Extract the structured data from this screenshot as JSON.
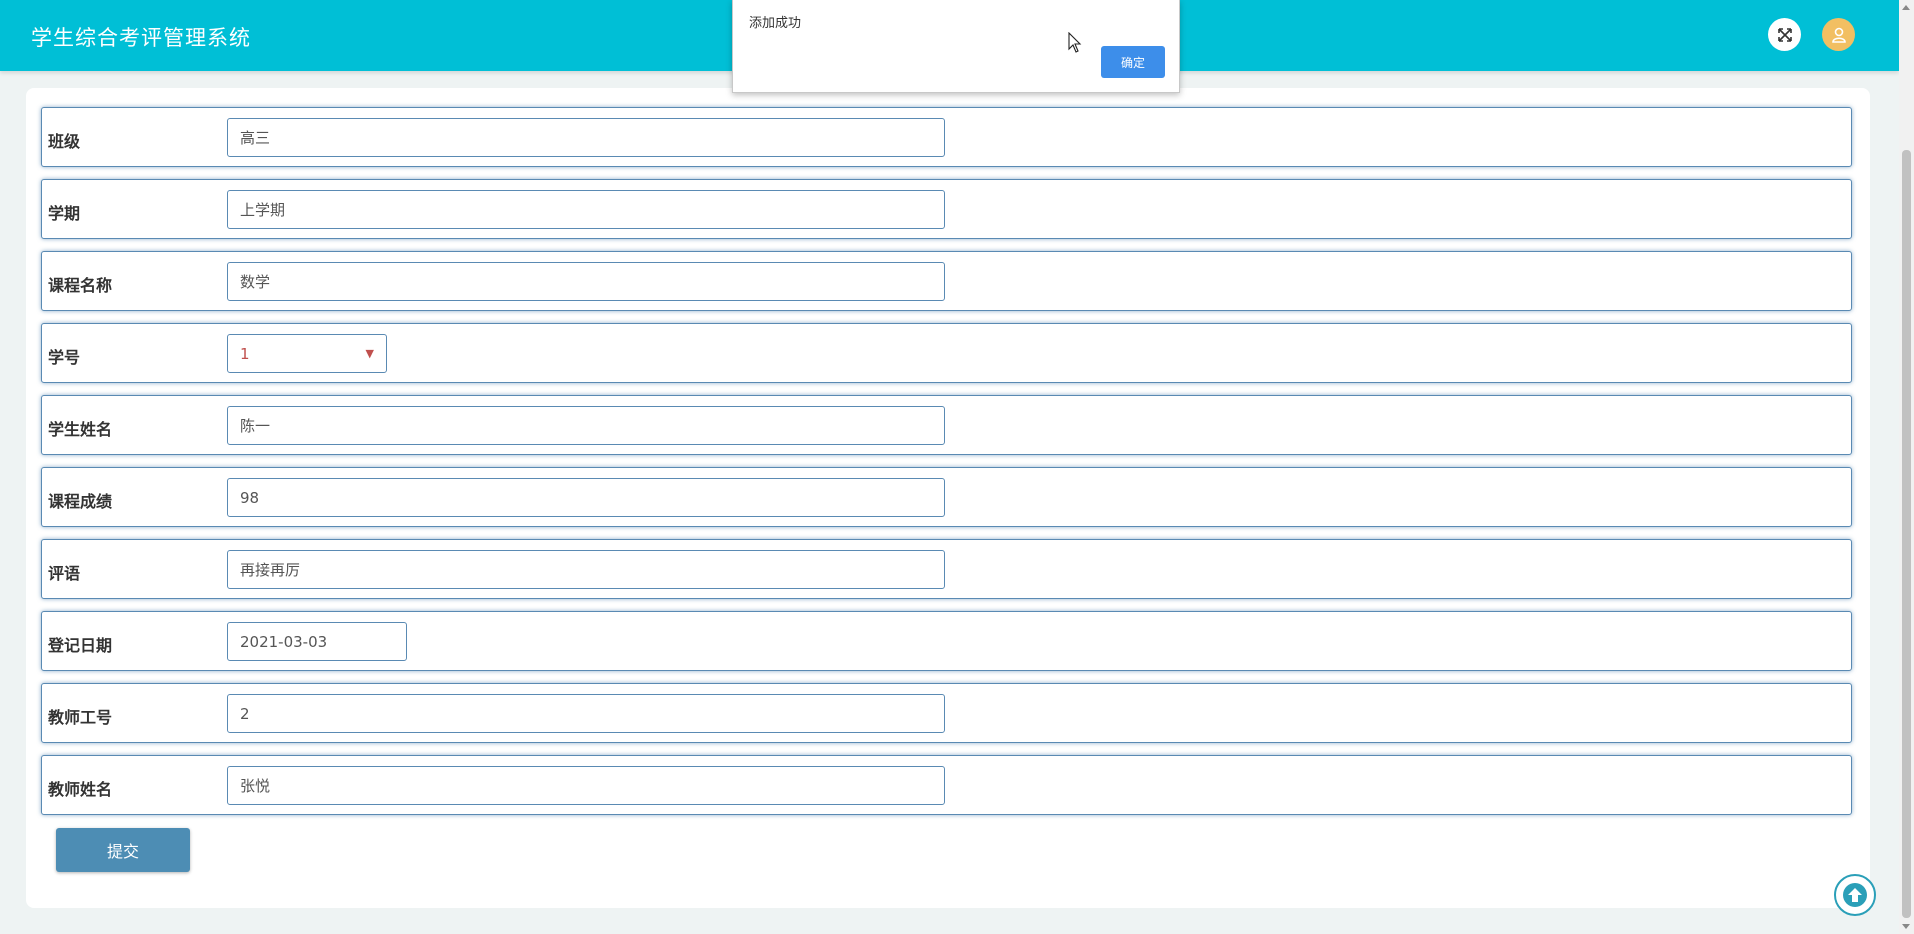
{
  "header": {
    "app_title": "学生综合考评管理系统",
    "fullscreen_icon": "fullscreen-icon",
    "user_icon": "user-icon"
  },
  "form": {
    "rows": [
      {
        "label": "班级",
        "value": "高三",
        "type": "text"
      },
      {
        "label": "学期",
        "value": "上学期",
        "type": "text"
      },
      {
        "label": "课程名称",
        "value": "数学",
        "type": "text"
      },
      {
        "label": "学号",
        "value": "1",
        "type": "select"
      },
      {
        "label": "学生姓名",
        "value": "陈一",
        "type": "text"
      },
      {
        "label": "课程成绩",
        "value": "98",
        "type": "text"
      },
      {
        "label": "评语",
        "value": "再接再厉",
        "type": "text"
      },
      {
        "label": "登记日期",
        "value": "2021-03-03",
        "type": "date"
      },
      {
        "label": "教师工号",
        "value": "2",
        "type": "text"
      },
      {
        "label": "教师姓名",
        "value": "张悦",
        "type": "text"
      }
    ],
    "submit_label": "提交"
  },
  "alert": {
    "message": "添加成功",
    "confirm_label": "确定"
  },
  "colors": {
    "header_bg": "#00bfd6",
    "row_border": "#5a8ab3",
    "submit_bg": "#4d8db4",
    "alert_button": "#3d8eea",
    "user_avatar": "#f2bf62"
  }
}
